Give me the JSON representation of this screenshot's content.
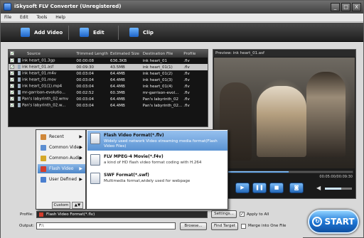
{
  "window": {
    "title": "iSkysoft FLV Converter (Unregistered)",
    "min": "_",
    "max": "□",
    "close": "X"
  },
  "menu": [
    "File",
    "Edit",
    "Tools",
    "Help"
  ],
  "toolbar": {
    "add_video": "Add Video",
    "edit": "Edit",
    "clip": "Clip"
  },
  "list": {
    "headers": [
      "Source",
      "Trimmed Length",
      "Estimated Size",
      "Destination File",
      "Profile"
    ],
    "rows": [
      {
        "source": "ink heart_01.3gp",
        "length": "00:00:08",
        "size": "636.3KB",
        "dest": "ink heart_01",
        "profile": ".flv",
        "selected": false
      },
      {
        "source": "ink heart_01.asf",
        "length": "00:09:30",
        "size": "43.5MB",
        "dest": "ink heart_01(1)",
        "profile": ".flv",
        "selected": true
      },
      {
        "source": "ink heart_01.m4v",
        "length": "00:03:04",
        "size": "64.4MB",
        "dest": "ink heart_01(2)",
        "profile": ".flv",
        "selected": false
      },
      {
        "source": "ink heart_01.mov",
        "length": "00:03:04",
        "size": "64.4MB",
        "dest": "ink heart_01(3)",
        "profile": ".flv",
        "selected": false
      },
      {
        "source": "ink heart_01(1).mp4",
        "length": "00:03:04",
        "size": "64.4MB",
        "dest": "ink heart_01(4)",
        "profile": ".flv",
        "selected": false
      },
      {
        "source": "mr-garrison-evolutio...",
        "length": "00:02:52",
        "size": "60.3MB",
        "dest": "mr-garrison-evol...",
        "profile": ".flv",
        "selected": false
      },
      {
        "source": "Pan's labyrinth_02.wmv",
        "length": "00:03:04",
        "size": "64.4MB",
        "dest": "Pan's labyrinth_02",
        "profile": ".flv",
        "selected": false
      },
      {
        "source": "Pan's labyrinth_02.w...",
        "length": "00:03:04",
        "size": "64.4MB",
        "dest": "Pan's labyrinth_02...",
        "profile": ".flv",
        "selected": false
      }
    ]
  },
  "preview": {
    "title": "Preview: ink heart_01.asf",
    "time": "00:05:00/00:09:30",
    "progress": 0.53
  },
  "popup": {
    "categories": [
      {
        "label": "Recent",
        "selected": false,
        "color": "#d0883a"
      },
      {
        "label": "Common Video",
        "selected": false,
        "color": "#5c8ed1"
      },
      {
        "label": "Common Audio",
        "selected": false,
        "color": "#d4a82a"
      },
      {
        "label": "Flash Video",
        "selected": true,
        "color": "#d23c2c"
      },
      {
        "label": "User Defined",
        "selected": false,
        "color": "#4a7fcf"
      }
    ],
    "custom": "Custom",
    "formats": [
      {
        "name": "Flash Video Format(*.flv)",
        "desc": "Widely used network Video streaming media format(Flash Video Files)",
        "selected": true
      },
      {
        "name": "FLV MPEG-4 Movie(*.f4v)",
        "desc": "a kind of HD flash video format coding with H.264",
        "selected": false
      },
      {
        "name": "SWF Format(*.swf)",
        "desc": "Multimedia format,widely used for webpage",
        "selected": false
      }
    ]
  },
  "bottom": {
    "profile_label": "Profile:",
    "profile_value": "Flash Video Format(*.flv)",
    "settings": "Settings...",
    "apply_all": "Apply to All",
    "output_label": "Output:",
    "output_value": "F:\\",
    "browse": "Browse...",
    "find_target": "Find Target",
    "merge": "Merge into One File",
    "start": "START"
  }
}
